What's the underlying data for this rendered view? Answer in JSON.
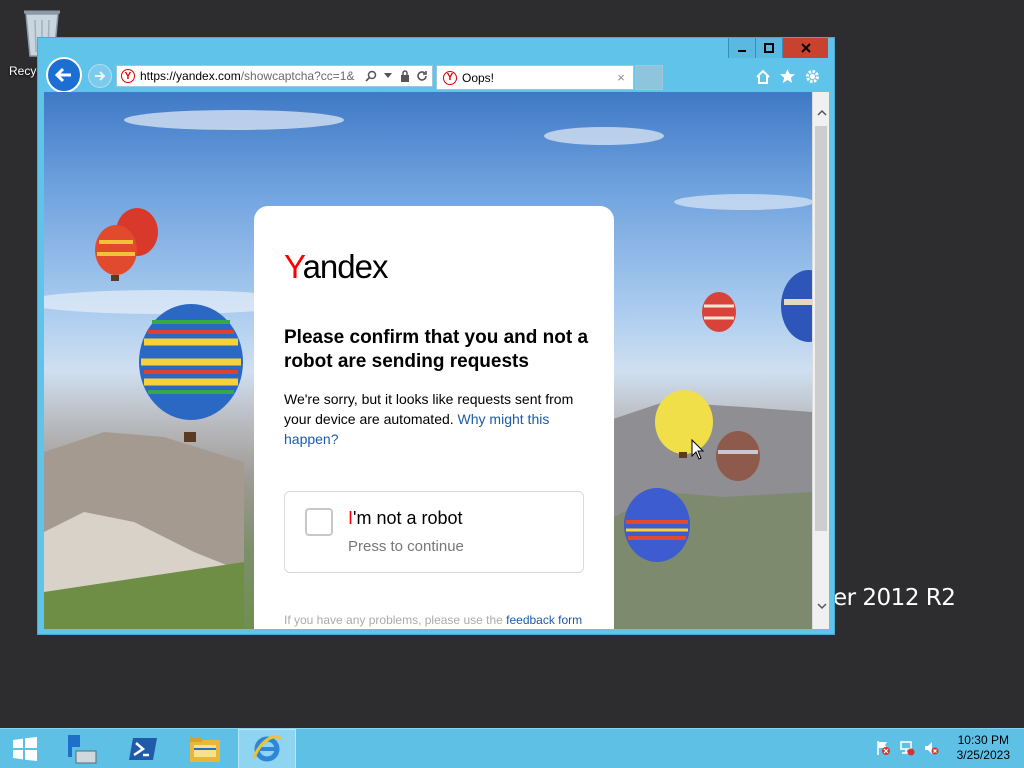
{
  "desktop": {
    "recycle_bin_label": "Recyc",
    "os_watermark": "er 2012 R2"
  },
  "browser": {
    "address": {
      "host": "https://yandex.com",
      "path": "/showcaptcha?cc=1&"
    },
    "tab": {
      "title": "Oops!",
      "close": "×"
    },
    "favicon_letter": "Y"
  },
  "captcha": {
    "logo_first": "Y",
    "logo_rest": "andex",
    "heading": "Please confirm that you and not a robot are sending requests",
    "description": "We're sorry, but it looks like requests sent from your device are automated. ",
    "why_link": "Why might this happen?",
    "checkbox_label_first": "I",
    "checkbox_label_rest": "'m not a robot",
    "checkbox_sub": "Press to continue",
    "footer_text": "If you have any problems, please use the ",
    "footer_link": "feedback form"
  },
  "taskbar": {
    "time": "10:30 PM",
    "date": "3/25/2023"
  },
  "colors": {
    "accent_red": "#fc0000",
    "link_blue": "#1c5aa8",
    "window_frame": "#60c3ea",
    "taskbar": "#5fc0e6"
  }
}
